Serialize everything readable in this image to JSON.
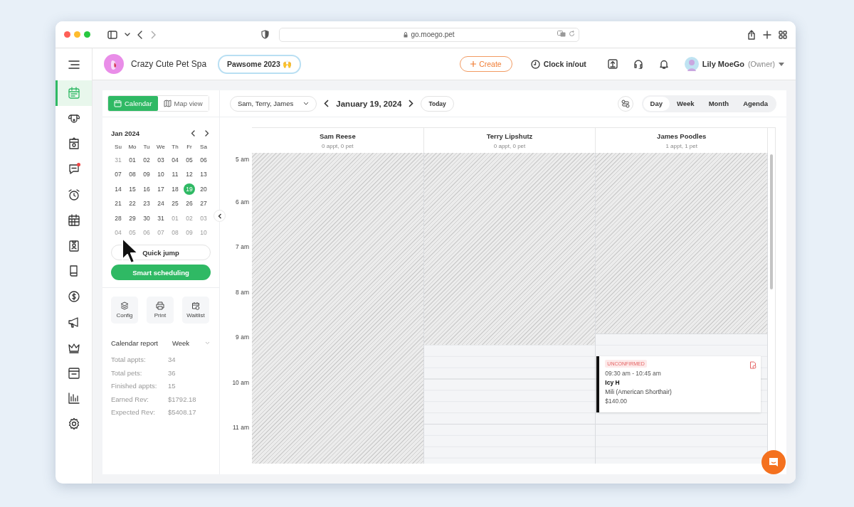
{
  "browser": {
    "url": "go.moego.pet"
  },
  "sidebar": {
    "items": [
      {
        "kind": "calendar",
        "selected": true,
        "notification": false
      },
      {
        "kind": "dog",
        "selected": false,
        "notification": false
      },
      {
        "kind": "store",
        "selected": false,
        "notification": false
      },
      {
        "kind": "chat",
        "selected": false,
        "notification": true
      },
      {
        "kind": "alarm",
        "selected": false,
        "notification": false
      },
      {
        "kind": "schedule",
        "selected": false,
        "notification": false
      },
      {
        "kind": "badge",
        "selected": false,
        "notification": false
      },
      {
        "kind": "book",
        "selected": false,
        "notification": false
      },
      {
        "kind": "dollar",
        "selected": false,
        "notification": false
      },
      {
        "kind": "megaphone",
        "selected": false,
        "notification": false
      },
      {
        "kind": "crown",
        "selected": false,
        "notification": false
      },
      {
        "kind": "window",
        "selected": false,
        "notification": false
      },
      {
        "kind": "chart",
        "selected": false,
        "notification": false
      },
      {
        "kind": "gear",
        "selected": false,
        "notification": false
      }
    ]
  },
  "header": {
    "business": "Crazy Cute Pet Spa",
    "campaign": "Pawsome 2023 🙌",
    "create": "Create",
    "clock": "Clock in/out",
    "user": {
      "name": "Lily MoeGo",
      "role": "(Owner)"
    }
  },
  "view_toggle": [
    {
      "label": "Calendar",
      "selected": true
    },
    {
      "label": "Map view",
      "selected": false
    }
  ],
  "mini_calendar": {
    "month": "Jan 2024",
    "weekdays": [
      "Su",
      "Mo",
      "Tu",
      "We",
      "Th",
      "Fr",
      "Sa"
    ],
    "weeks": [
      [
        {
          "day": "31",
          "in_month": false,
          "selected": false
        },
        {
          "day": "01",
          "in_month": true,
          "selected": false
        },
        {
          "day": "02",
          "in_month": true,
          "selected": false
        },
        {
          "day": "03",
          "in_month": true,
          "selected": false
        },
        {
          "day": "04",
          "in_month": true,
          "selected": false
        },
        {
          "day": "05",
          "in_month": true,
          "selected": false
        },
        {
          "day": "06",
          "in_month": true,
          "selected": false
        }
      ],
      [
        {
          "day": "07",
          "in_month": true,
          "selected": false
        },
        {
          "day": "08",
          "in_month": true,
          "selected": false
        },
        {
          "day": "09",
          "in_month": true,
          "selected": false
        },
        {
          "day": "10",
          "in_month": true,
          "selected": false
        },
        {
          "day": "11",
          "in_month": true,
          "selected": false
        },
        {
          "day": "12",
          "in_month": true,
          "selected": false
        },
        {
          "day": "13",
          "in_month": true,
          "selected": false
        }
      ],
      [
        {
          "day": "14",
          "in_month": true,
          "selected": false
        },
        {
          "day": "15",
          "in_month": true,
          "selected": false
        },
        {
          "day": "16",
          "in_month": true,
          "selected": false
        },
        {
          "day": "17",
          "in_month": true,
          "selected": false
        },
        {
          "day": "18",
          "in_month": true,
          "selected": false
        },
        {
          "day": "19",
          "in_month": true,
          "selected": true
        },
        {
          "day": "20",
          "in_month": true,
          "selected": false
        }
      ],
      [
        {
          "day": "21",
          "in_month": true,
          "selected": false
        },
        {
          "day": "22",
          "in_month": true,
          "selected": false
        },
        {
          "day": "23",
          "in_month": true,
          "selected": false
        },
        {
          "day": "24",
          "in_month": true,
          "selected": false
        },
        {
          "day": "25",
          "in_month": true,
          "selected": false
        },
        {
          "day": "26",
          "in_month": true,
          "selected": false
        },
        {
          "day": "27",
          "in_month": true,
          "selected": false
        }
      ],
      [
        {
          "day": "28",
          "in_month": true,
          "selected": false
        },
        {
          "day": "29",
          "in_month": true,
          "selected": false
        },
        {
          "day": "30",
          "in_month": true,
          "selected": false
        },
        {
          "day": "31",
          "in_month": true,
          "selected": false
        },
        {
          "day": "01",
          "in_month": false,
          "selected": false
        },
        {
          "day": "02",
          "in_month": false,
          "selected": false
        },
        {
          "day": "03",
          "in_month": false,
          "selected": false
        }
      ],
      [
        {
          "day": "04",
          "in_month": false,
          "selected": false
        },
        {
          "day": "05",
          "in_month": false,
          "selected": false
        },
        {
          "day": "06",
          "in_month": false,
          "selected": false
        },
        {
          "day": "07",
          "in_month": false,
          "selected": false
        },
        {
          "day": "08",
          "in_month": false,
          "selected": false
        },
        {
          "day": "09",
          "in_month": false,
          "selected": false
        },
        {
          "day": "10",
          "in_month": false,
          "selected": false
        }
      ]
    ]
  },
  "quick_jump": "Quick jump",
  "smart_scheduling": "Smart scheduling",
  "tools": [
    {
      "kind": "layers",
      "label": "Config"
    },
    {
      "kind": "printer",
      "label": "Print"
    },
    {
      "kind": "waitlist",
      "label": "Waitlist"
    }
  ],
  "report": {
    "title": "Calendar report",
    "period": "Week",
    "stats": [
      {
        "label": "Total appts:",
        "value": "34"
      },
      {
        "label": "Total pets:",
        "value": "36"
      },
      {
        "label": "Finished appts:",
        "value": "15"
      },
      {
        "label": "Earned Rev:",
        "value": "$1792.18"
      },
      {
        "label": "Expected Rev:",
        "value": "$5408.17"
      }
    ]
  },
  "toolbar": {
    "staff_filter": "Sam, Terry, James",
    "date": "January 19, 2024",
    "today": "Today",
    "views": [
      {
        "label": "Day",
        "selected": true
      },
      {
        "label": "Week",
        "selected": false
      },
      {
        "label": "Month",
        "selected": false
      },
      {
        "label": "Agenda",
        "selected": false
      }
    ]
  },
  "schedule": {
    "hours": [
      "5 am",
      "6 am",
      "7 am",
      "8 am",
      "9 am",
      "10 am",
      "11 am"
    ],
    "staff": [
      {
        "name": "Sam Reese",
        "summary": "0 appt, 0 pet",
        "level": 1
      },
      {
        "name": "Terry Lipshutz",
        "summary": "0 appt, 0 pet",
        "level": 0.607
      },
      {
        "name": "James Poodles",
        "summary": "1 appt, 1 pet",
        "level": 0.571,
        "appointments": [
          {
            "status": "UNCONFIRMED",
            "confirmed": false,
            "time": "09:30 am - 10:45 am",
            "client": "Icy H",
            "pet": "Mili (American Shorthair)",
            "price": "$140.00"
          }
        ]
      }
    ]
  }
}
